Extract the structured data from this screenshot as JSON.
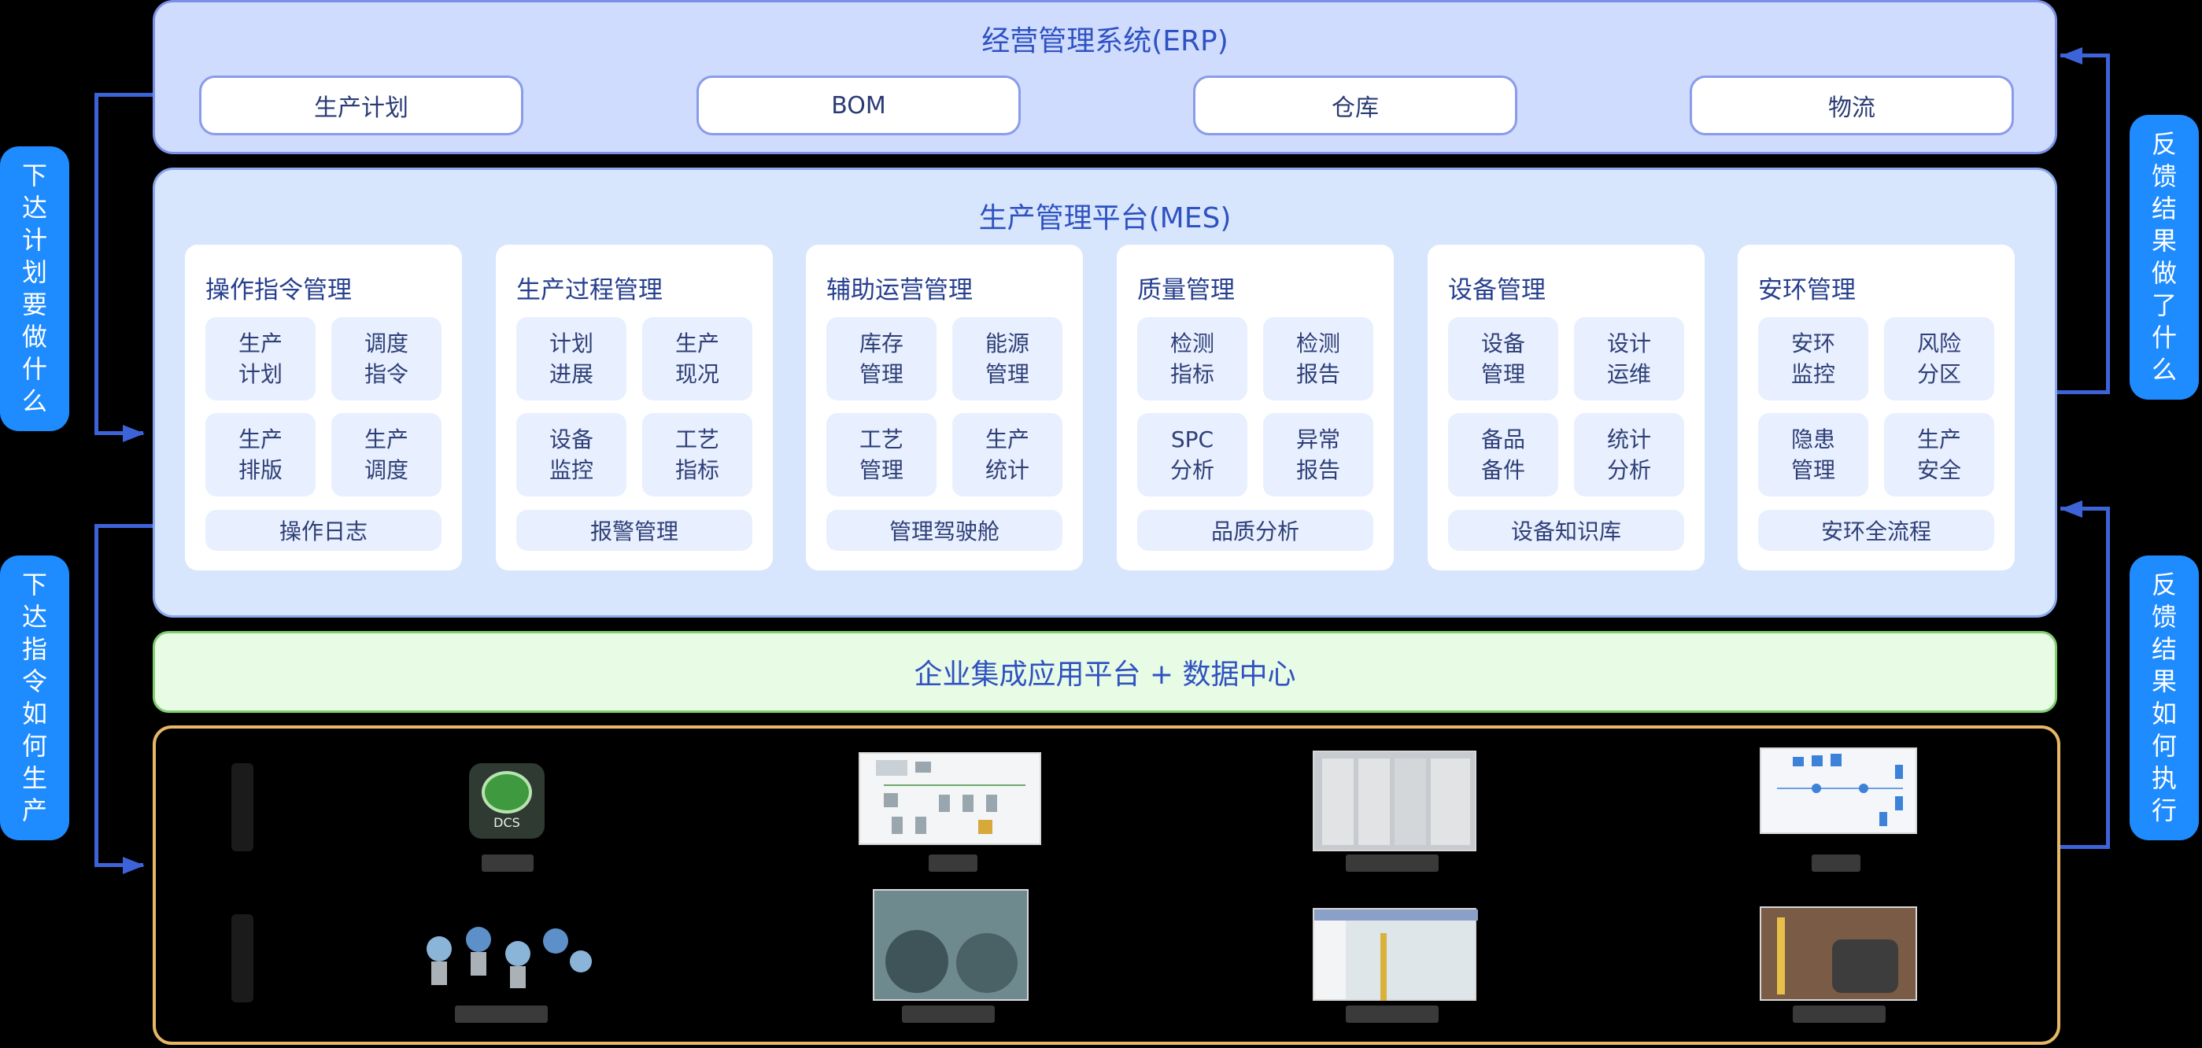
{
  "erp": {
    "title": "经营管理系统(ERP)",
    "items": [
      "生产计划",
      "BOM",
      "仓库",
      "物流"
    ]
  },
  "mes": {
    "title": "生产管理平台(MES)",
    "modules": [
      {
        "title": "操作指令管理",
        "tiles": [
          "生产\n计划",
          "调度\n指令",
          "生产\n排版",
          "生产\n调度"
        ],
        "wide": "操作日志"
      },
      {
        "title": "生产过程管理",
        "tiles": [
          "计划\n进展",
          "生产\n现况",
          "设备\n监控",
          "工艺\n指标"
        ],
        "wide": "报警管理"
      },
      {
        "title": "辅助运营管理",
        "tiles": [
          "库存\n管理",
          "能源\n管理",
          "工艺\n管理",
          "生产\n统计"
        ],
        "wide": "管理驾驶舱"
      },
      {
        "title": "质量管理",
        "tiles": [
          "检测\n指标",
          "检测\n报告",
          "SPC\n分析",
          "异常\n报告"
        ],
        "wide": "品质分析"
      },
      {
        "title": "设备管理",
        "tiles": [
          "设备\n管理",
          "设计\n运维",
          "备品\n备件",
          "统计\n分析"
        ],
        "wide": "设备知识库"
      },
      {
        "title": "安环管理",
        "tiles": [
          "安环\n监控",
          "风险\n分区",
          "隐患\n管理",
          "生产\n安全"
        ],
        "wide": "安环全流程"
      }
    ]
  },
  "platform": {
    "label": "企业集成应用平台 + 数据中心"
  },
  "field": {
    "dcs_label": "DCS"
  },
  "side_labels": {
    "top_left": "下达计划要做什么",
    "bottom_left": "下达指令如何生产",
    "top_right": "反馈结果做了什么",
    "bottom_right": "反馈结果如何执行"
  },
  "colors": {
    "erp_bg": "#cfdcfd",
    "mes_bg": "#d8e6fd",
    "platform_bg": "#e8fbe5",
    "field_border": "#e7b765",
    "side_label_bg": "#1e8bff",
    "connector": "#3d63d8"
  }
}
